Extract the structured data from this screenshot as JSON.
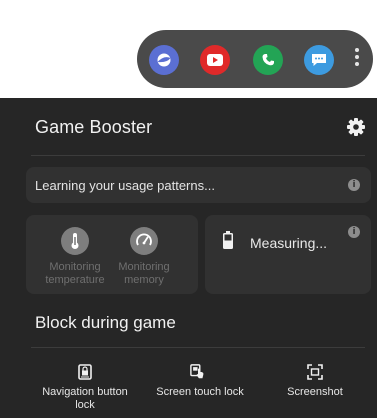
{
  "edge_panel": {
    "apps": [
      {
        "icon": "samsung-internet-icon",
        "color": "#5b6fd3"
      },
      {
        "icon": "youtube-icon",
        "color": "#e02a2a"
      },
      {
        "icon": "phone-icon",
        "color": "#23a455"
      },
      {
        "icon": "messages-icon",
        "color": "#3d9be0"
      }
    ],
    "more_icon": "more-vertical-icon"
  },
  "booster": {
    "title": "Game Booster",
    "settings_icon": "gear-icon",
    "learning": {
      "text": "Learning your usage patterns...",
      "info_icon": "i"
    },
    "monitoring": [
      {
        "label_line1": "Monitoring",
        "label_line2": "temperature",
        "icon": "thermometer-icon"
      },
      {
        "label_line1": "Monitoring",
        "label_line2": "memory",
        "icon": "speedometer-icon"
      }
    ],
    "battery": {
      "text": "Measuring...",
      "info_icon": "i"
    },
    "block_title": "Block during game",
    "block_items": [
      {
        "line1": "Navigation button",
        "line2": "lock",
        "icon": "navigation-lock-icon"
      },
      {
        "line1": "Screen touch lock",
        "line2": "",
        "icon": "touch-lock-icon"
      },
      {
        "line1": "Screenshot",
        "line2": "",
        "icon": "screenshot-icon"
      }
    ]
  },
  "colors": {
    "panel_bg": "#262626",
    "card_bg": "#313131",
    "edge_bg": "#4a4a4a"
  }
}
